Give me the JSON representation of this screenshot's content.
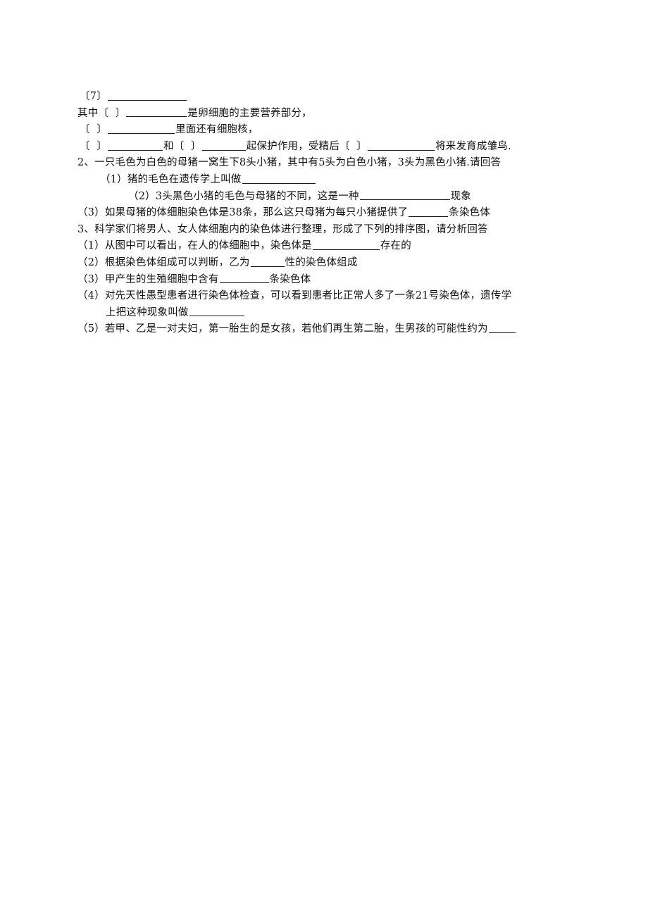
{
  "document": {
    "page_background": "#ffffff",
    "text_color": "#111111",
    "lines": [
      {
        "id": "line-bracket-7",
        "indent": "ind-1",
        "segments": [
          {
            "type": "text",
            "text": "〔7〕"
          },
          {
            "type": "blank",
            "width": "b-112"
          }
        ]
      },
      {
        "id": "line-qizhong-yolk",
        "indent": "ind-0",
        "segments": [
          {
            "type": "text",
            "text": "其中〔  〕"
          },
          {
            "type": "blank",
            "width": "b-86"
          },
          {
            "type": "text",
            "text": "是卵细胞的主要营养部分，"
          }
        ]
      },
      {
        "id": "line-nucleus",
        "indent": "ind-1",
        "segments": [
          {
            "type": "text",
            "text": "〔  〕"
          },
          {
            "type": "blank",
            "width": "b-95"
          },
          {
            "type": "text",
            "text": "里面还有细胞核，"
          }
        ]
      },
      {
        "id": "line-protection",
        "indent": "ind-1",
        "segments": [
          {
            "type": "text",
            "text": "〔  〕"
          },
          {
            "type": "blank",
            "width": "b-78"
          },
          {
            "type": "text",
            "text": "和〔  〕"
          },
          {
            "type": "blank",
            "width": "b-62"
          },
          {
            "type": "text",
            "text": "起保护作用，受精后〔  〕"
          },
          {
            "type": "blank",
            "width": "b-95"
          },
          {
            "type": "text",
            "text": "将来发育成雏鸟."
          }
        ]
      },
      {
        "id": "line-q2-stem",
        "indent": "ind-0",
        "segments": [
          {
            "type": "text",
            "text": "2、一只毛色为白色的母猪一窝生下8头小猪，其中有5头为白色小猪，3头为黑色小猪.请回答"
          }
        ]
      },
      {
        "id": "line-q2-1",
        "indent": "ind-2",
        "segments": [
          {
            "type": "text",
            "text": "（1）猪的毛色在遗传学上叫做"
          },
          {
            "type": "blank",
            "width": "b-104"
          }
        ]
      },
      {
        "id": "line-q2-2",
        "indent": "ind-3",
        "segments": [
          {
            "type": "text",
            "text": "（2）3头黑色小猪的毛色与母猪的不同，这是一种"
          },
          {
            "type": "blank",
            "width": "b-128"
          },
          {
            "type": "text",
            "text": "现象"
          }
        ]
      },
      {
        "id": "line-q2-3",
        "indent": "ind-0",
        "segments": [
          {
            "type": "text",
            "text": "（3）如果母猪的体细胞染色体是38条，那么这只母猪为每只小猪提供了"
          },
          {
            "type": "blank",
            "width": "b-56"
          },
          {
            "type": "text",
            "text": "条染色体"
          }
        ]
      },
      {
        "id": "line-q3-stem",
        "indent": "ind-0",
        "segments": [
          {
            "type": "text",
            "text": "3、科学家们将男人、女人体细胞内的染色体进行整理，形成了下列的排序图，请分析回答"
          }
        ]
      },
      {
        "id": "line-q3-1",
        "indent": "ind-0",
        "segments": [
          {
            "type": "text",
            "text": "（1）从图中可以看出，在人的体细胞中，染色体是"
          },
          {
            "type": "blank",
            "width": "b-95"
          },
          {
            "type": "text",
            "text": "存在的"
          }
        ]
      },
      {
        "id": "line-q3-2",
        "indent": "ind-0",
        "segments": [
          {
            "type": "text",
            "text": "（2）根据染色体组成可以判断，乙为"
          },
          {
            "type": "blank",
            "width": "b-48"
          },
          {
            "type": "text",
            "text": "性的染色体组成"
          }
        ]
      },
      {
        "id": "line-q3-3",
        "indent": "ind-0",
        "segments": [
          {
            "type": "text",
            "text": "（3）甲产生的生殖细胞中含有"
          },
          {
            "type": "blank",
            "width": "b-70"
          },
          {
            "type": "text",
            "text": "条染色体"
          }
        ]
      },
      {
        "id": "line-q3-4a",
        "indent": "ind-0",
        "segments": [
          {
            "type": "text",
            "text": "（4）对先天性愚型患者进行染色体检查，可以看到患者比正常人多了一条21号染色体，遗传学"
          }
        ]
      },
      {
        "id": "line-q3-4b",
        "indent": "ind-4",
        "segments": [
          {
            "type": "text",
            "text": "上把这种现象叫做"
          },
          {
            "type": "blank",
            "width": "b-78"
          }
        ]
      },
      {
        "id": "line-q3-5",
        "indent": "ind-0",
        "segments": [
          {
            "type": "text",
            "text": "（5）若甲、乙是一对夫妇，第一胎生的是女孩，若他们再生第二胎，生男孩的可能性约为"
          },
          {
            "type": "blank",
            "width": "b-38"
          }
        ]
      }
    ]
  }
}
